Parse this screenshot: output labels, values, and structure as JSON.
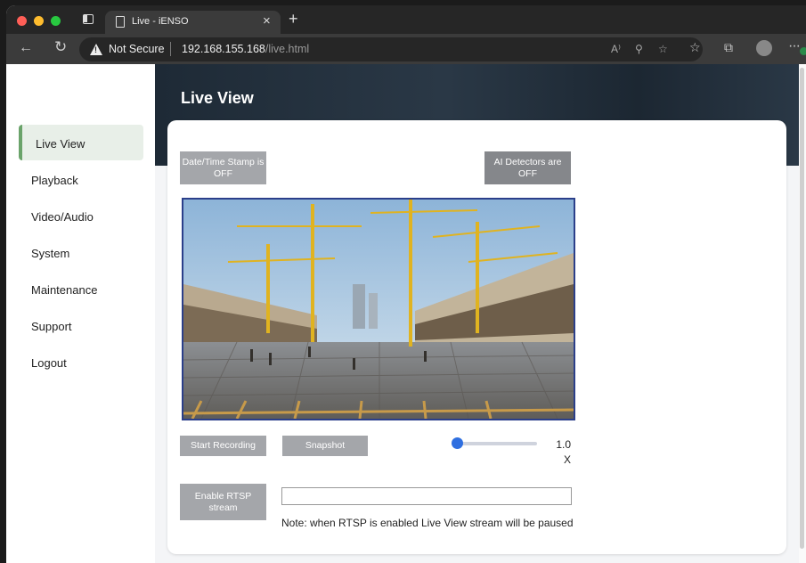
{
  "browser": {
    "tab_title": "Live - iENSO",
    "tab_close": "×",
    "new_tab": "+",
    "not_secure": "Not Secure",
    "url_host": "192.168.155.168",
    "url_path": "/live.html"
  },
  "sidebar": {
    "items": [
      {
        "label": "Live View",
        "active": true
      },
      {
        "label": "Playback"
      },
      {
        "label": "Video/Audio"
      },
      {
        "label": "System"
      },
      {
        "label": "Maintenance"
      },
      {
        "label": "Support"
      },
      {
        "label": "Logout"
      }
    ]
  },
  "header": {
    "title": "Live View"
  },
  "live": {
    "timestamp_button": "Date/Time Stamp is OFF",
    "ai_button": "AI Detectors are OFF",
    "start_recording": "Start Recording",
    "snapshot": "Snapshot",
    "zoom_value": "1.0 X",
    "zoom_level": 0,
    "enable_rtsp": "Enable RTSP stream",
    "rtsp_value": "",
    "rtsp_note": "Note: when RTSP is enabled Live View stream will be paused"
  },
  "colors": {
    "accent": "#6aa36a",
    "button": "#a4a6aa",
    "slider": "#2f6fe0",
    "video_border": "#2b3f8a"
  }
}
